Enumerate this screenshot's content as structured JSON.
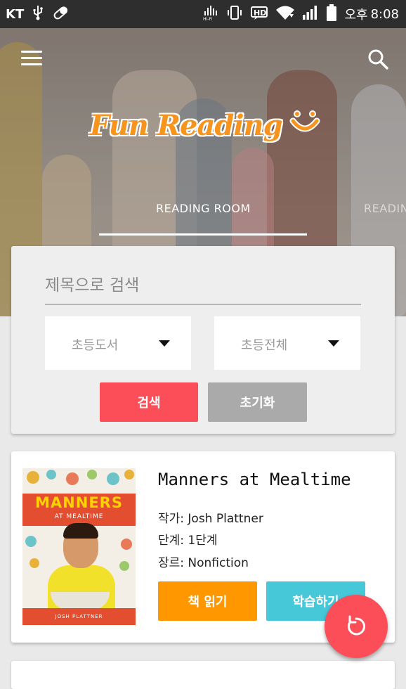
{
  "status_bar": {
    "carrier": "KT",
    "time_prefix": "오후",
    "time": "8:08",
    "icons": [
      "usb-icon",
      "pill-icon",
      "hifi-icon",
      "vibrate-icon",
      "hd-icon",
      "wifi-icon",
      "signal-icon",
      "battery-icon"
    ]
  },
  "header": {
    "logo_text": "Fun Reading",
    "tabs": [
      "READING ROOM",
      "READIN"
    ],
    "active_tab": 0
  },
  "search": {
    "placeholder": "제목으로 검색",
    "category_select": "초등도서",
    "level_select": "초등전체",
    "search_label": "검색",
    "reset_label": "초기화"
  },
  "book": {
    "title": "Manners at Mealtime",
    "author": "작가: Josh Plattner",
    "level": "단계: 1단계",
    "genre": "장르: Nonfiction",
    "cover_title": "MANNERS",
    "cover_subtitle": "AT MEALTIME",
    "cover_author": "JOSH PLATTNER",
    "read_label": "책 읽기",
    "study_label": "학습하기"
  },
  "colors": {
    "accent_red": "#fb4e59",
    "orange": "#ff9800",
    "cyan": "#46c8d9",
    "logo_orange": "#f7941d"
  }
}
